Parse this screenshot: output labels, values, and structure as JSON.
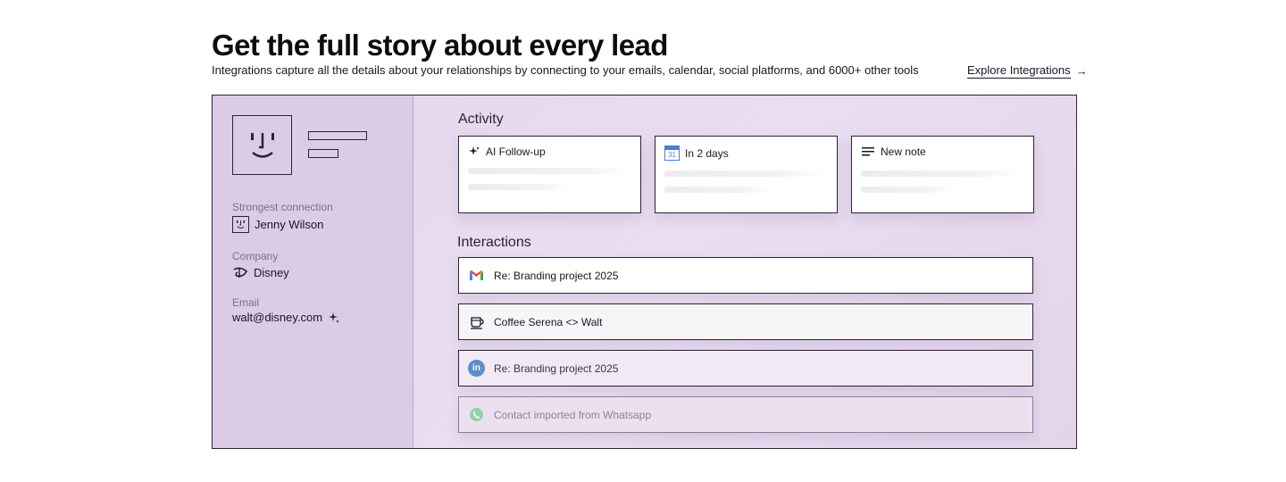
{
  "header": {
    "title": "Get the full story about every lead",
    "subtitle": "Integrations capture all the details about your relationships by connecting to your emails, calendar, social platforms, and 6000+ other tools",
    "explore_label": "Explore Integrations",
    "explore_arrow": "→"
  },
  "profile": {
    "strongest_label": "Strongest connection",
    "strongest_value": "Jenny Wilson",
    "company_label": "Company",
    "company_value": "Disney",
    "email_label": "Email",
    "email_value": "walt@disney.com"
  },
  "activity": {
    "title": "Activity",
    "cards": [
      {
        "label": "AI Follow-up",
        "icon": "sparkle-icon"
      },
      {
        "label": "In 2 days",
        "icon": "calendar-icon",
        "icon_text": "31"
      },
      {
        "label": "New note",
        "icon": "note-lines-icon"
      }
    ]
  },
  "interactions": {
    "title": "Interactions",
    "rows": [
      {
        "label": "Re: Branding project 2025",
        "icon": "gmail-icon"
      },
      {
        "label": "Coffee Serena <> Walt",
        "icon": "coffee-cup-icon"
      },
      {
        "label": "Re: Branding project 2025",
        "icon": "linkedin-icon",
        "icon_text": "in"
      },
      {
        "label": "Contact imported from Whatsapp",
        "icon": "whatsapp-icon"
      }
    ]
  },
  "colors": {
    "panel_bg": "#e6d9ee",
    "sidebar_bg": "#dccbe6",
    "border": "#2a2433",
    "linkedin": "#5b8fc9",
    "whatsapp": "#8fd3a6"
  }
}
